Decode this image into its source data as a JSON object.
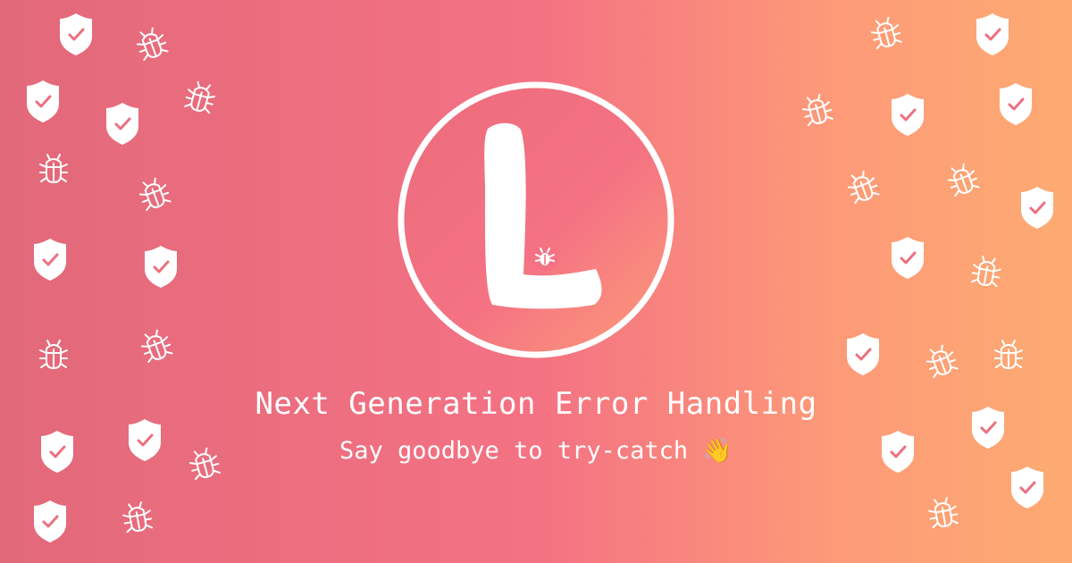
{
  "headline": "Next Generation Error Handling",
  "subline": "Say goodbye to try-catch",
  "wave_emoji": "👋",
  "logo": {
    "letter": "L",
    "ring_color": "#ffffff",
    "badge_color": "#f47283"
  },
  "colors": {
    "gradient_left": "#e2697a",
    "gradient_mid": "#f47283",
    "gradient_right": "#fdab72",
    "text": "#ffffff"
  },
  "icons": {
    "shield": "shield-check-icon",
    "bug": "bug-icon"
  }
}
